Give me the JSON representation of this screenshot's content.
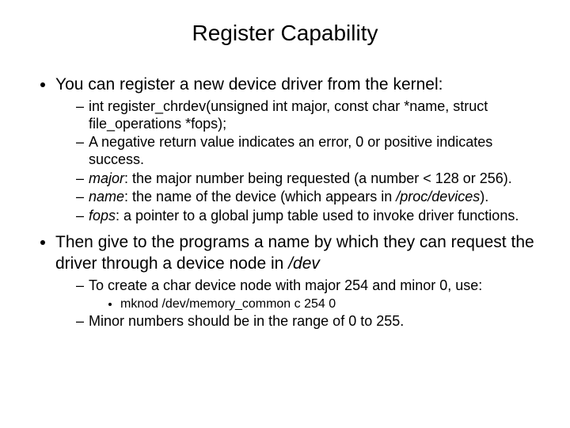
{
  "title": "Register Capability",
  "bullets": [
    {
      "text": "You can register a new device driver from the kernel:",
      "sub": [
        {
          "html": "int register_chrdev(unsigned int major, const char *name, struct file_operations *fops);"
        },
        {
          "html": "A negative return value indicates an error, 0 or positive indicates success."
        },
        {
          "html": "<span class='ital'>major</span>: the major number being requested (a number &lt; 128 or 256)."
        },
        {
          "html": "<span class='ital'>name</span>: the name of the device (which appears in <span class='ital'>/proc/devices</span>)."
        },
        {
          "html": "<span class='ital'>fops</span>: a pointer to a global jump table used to invoke driver functions."
        }
      ]
    },
    {
      "html": "Then give to the programs a name by which they can request the driver through a device node in <span class='ital'>/dev</span>",
      "sub": [
        {
          "html": "To create a char device node with major 254 and minor 0, use:",
          "sub3": [
            {
              "html": "mknod /dev/memory_common c 254 0"
            }
          ]
        },
        {
          "html": "Minor numbers should be in the range of 0 to 255."
        }
      ]
    }
  ]
}
